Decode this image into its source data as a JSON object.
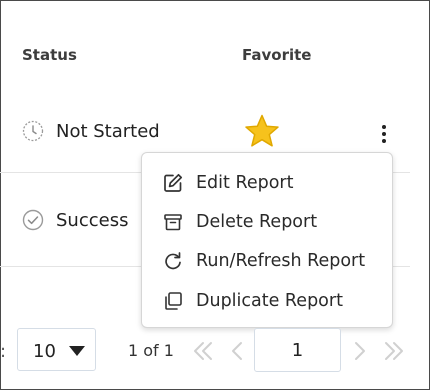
{
  "table": {
    "headers": {
      "status": "Status",
      "favorite": "Favorite"
    },
    "rows": [
      {
        "status": "Not Started",
        "status_icon": "clock-icon",
        "favorite_icon": "star-icon"
      },
      {
        "status": "Success",
        "status_icon": "check-circle-icon"
      }
    ]
  },
  "menu": {
    "items": [
      {
        "label": "Edit Report",
        "icon": "edit-icon"
      },
      {
        "label": "Delete Report",
        "icon": "archive-icon"
      },
      {
        "label": "Run/Refresh Report",
        "icon": "refresh-icon"
      },
      {
        "label": "Duplicate Report",
        "icon": "duplicate-icon"
      }
    ]
  },
  "pagination": {
    "prefix": ":",
    "page_size": "10",
    "page_info": "1 of 1",
    "current_page": "1"
  },
  "colors": {
    "star": "#f6c21c",
    "star_outline": "#e0a800",
    "muted_icon": "#9a9a9a",
    "border": "#d5dde6"
  }
}
